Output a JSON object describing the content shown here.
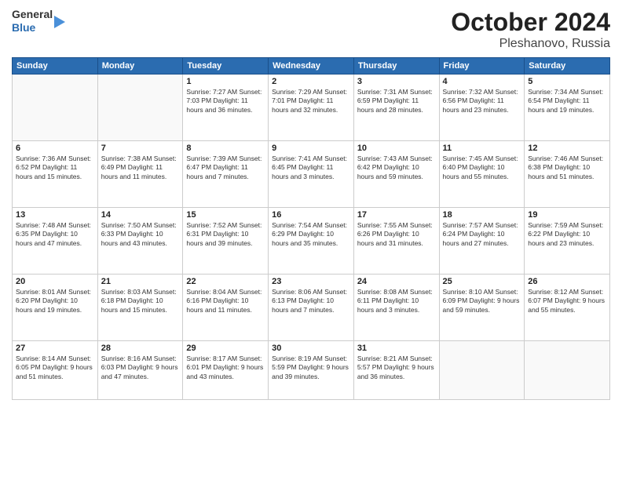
{
  "header": {
    "logo_general": "General",
    "logo_blue": "Blue",
    "title": "October 2024",
    "subtitle": "Pleshanovo, Russia"
  },
  "days_of_week": [
    "Sunday",
    "Monday",
    "Tuesday",
    "Wednesday",
    "Thursday",
    "Friday",
    "Saturday"
  ],
  "weeks": [
    [
      {
        "num": "",
        "info": ""
      },
      {
        "num": "",
        "info": ""
      },
      {
        "num": "1",
        "info": "Sunrise: 7:27 AM\nSunset: 7:03 PM\nDaylight: 11 hours and 36 minutes."
      },
      {
        "num": "2",
        "info": "Sunrise: 7:29 AM\nSunset: 7:01 PM\nDaylight: 11 hours and 32 minutes."
      },
      {
        "num": "3",
        "info": "Sunrise: 7:31 AM\nSunset: 6:59 PM\nDaylight: 11 hours and 28 minutes."
      },
      {
        "num": "4",
        "info": "Sunrise: 7:32 AM\nSunset: 6:56 PM\nDaylight: 11 hours and 23 minutes."
      },
      {
        "num": "5",
        "info": "Sunrise: 7:34 AM\nSunset: 6:54 PM\nDaylight: 11 hours and 19 minutes."
      }
    ],
    [
      {
        "num": "6",
        "info": "Sunrise: 7:36 AM\nSunset: 6:52 PM\nDaylight: 11 hours and 15 minutes."
      },
      {
        "num": "7",
        "info": "Sunrise: 7:38 AM\nSunset: 6:49 PM\nDaylight: 11 hours and 11 minutes."
      },
      {
        "num": "8",
        "info": "Sunrise: 7:39 AM\nSunset: 6:47 PM\nDaylight: 11 hours and 7 minutes."
      },
      {
        "num": "9",
        "info": "Sunrise: 7:41 AM\nSunset: 6:45 PM\nDaylight: 11 hours and 3 minutes."
      },
      {
        "num": "10",
        "info": "Sunrise: 7:43 AM\nSunset: 6:42 PM\nDaylight: 10 hours and 59 minutes."
      },
      {
        "num": "11",
        "info": "Sunrise: 7:45 AM\nSunset: 6:40 PM\nDaylight: 10 hours and 55 minutes."
      },
      {
        "num": "12",
        "info": "Sunrise: 7:46 AM\nSunset: 6:38 PM\nDaylight: 10 hours and 51 minutes."
      }
    ],
    [
      {
        "num": "13",
        "info": "Sunrise: 7:48 AM\nSunset: 6:35 PM\nDaylight: 10 hours and 47 minutes."
      },
      {
        "num": "14",
        "info": "Sunrise: 7:50 AM\nSunset: 6:33 PM\nDaylight: 10 hours and 43 minutes."
      },
      {
        "num": "15",
        "info": "Sunrise: 7:52 AM\nSunset: 6:31 PM\nDaylight: 10 hours and 39 minutes."
      },
      {
        "num": "16",
        "info": "Sunrise: 7:54 AM\nSunset: 6:29 PM\nDaylight: 10 hours and 35 minutes."
      },
      {
        "num": "17",
        "info": "Sunrise: 7:55 AM\nSunset: 6:26 PM\nDaylight: 10 hours and 31 minutes."
      },
      {
        "num": "18",
        "info": "Sunrise: 7:57 AM\nSunset: 6:24 PM\nDaylight: 10 hours and 27 minutes."
      },
      {
        "num": "19",
        "info": "Sunrise: 7:59 AM\nSunset: 6:22 PM\nDaylight: 10 hours and 23 minutes."
      }
    ],
    [
      {
        "num": "20",
        "info": "Sunrise: 8:01 AM\nSunset: 6:20 PM\nDaylight: 10 hours and 19 minutes."
      },
      {
        "num": "21",
        "info": "Sunrise: 8:03 AM\nSunset: 6:18 PM\nDaylight: 10 hours and 15 minutes."
      },
      {
        "num": "22",
        "info": "Sunrise: 8:04 AM\nSunset: 6:16 PM\nDaylight: 10 hours and 11 minutes."
      },
      {
        "num": "23",
        "info": "Sunrise: 8:06 AM\nSunset: 6:13 PM\nDaylight: 10 hours and 7 minutes."
      },
      {
        "num": "24",
        "info": "Sunrise: 8:08 AM\nSunset: 6:11 PM\nDaylight: 10 hours and 3 minutes."
      },
      {
        "num": "25",
        "info": "Sunrise: 8:10 AM\nSunset: 6:09 PM\nDaylight: 9 hours and 59 minutes."
      },
      {
        "num": "26",
        "info": "Sunrise: 8:12 AM\nSunset: 6:07 PM\nDaylight: 9 hours and 55 minutes."
      }
    ],
    [
      {
        "num": "27",
        "info": "Sunrise: 8:14 AM\nSunset: 6:05 PM\nDaylight: 9 hours and 51 minutes."
      },
      {
        "num": "28",
        "info": "Sunrise: 8:16 AM\nSunset: 6:03 PM\nDaylight: 9 hours and 47 minutes."
      },
      {
        "num": "29",
        "info": "Sunrise: 8:17 AM\nSunset: 6:01 PM\nDaylight: 9 hours and 43 minutes."
      },
      {
        "num": "30",
        "info": "Sunrise: 8:19 AM\nSunset: 5:59 PM\nDaylight: 9 hours and 39 minutes."
      },
      {
        "num": "31",
        "info": "Sunrise: 8:21 AM\nSunset: 5:57 PM\nDaylight: 9 hours and 36 minutes."
      },
      {
        "num": "",
        "info": ""
      },
      {
        "num": "",
        "info": ""
      }
    ]
  ]
}
